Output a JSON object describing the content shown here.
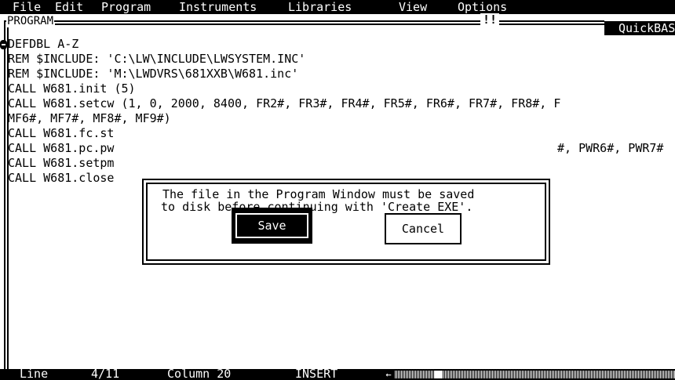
{
  "menu": [
    {
      "name": "menu-file",
      "label": "File"
    },
    {
      "name": "menu-edit",
      "label": "Edit"
    },
    {
      "name": "menu-program",
      "label": "Program"
    },
    {
      "name": "menu-instruments",
      "label": "Instruments"
    },
    {
      "name": "menu-libraries",
      "label": "Libraries"
    },
    {
      "name": "menu-view",
      "label": "View"
    },
    {
      "name": "menu-options",
      "label": "Options"
    }
  ],
  "window": {
    "title": "PROGRAM",
    "marker": "!!",
    "brand": "QuickBASIC"
  },
  "code": {
    "lines": [
      "DEFDBL A-Z",
      "REM $INCLUDE: 'C:\\LW\\INCLUDE\\LWSYSTEM.INC'",
      "REM $INCLUDE: 'M:\\LWDVRS\\681XXB\\W681.inc'",
      "CALL W681.init (5)",
      "CALL W681.setcw (1, 0, 2000, 8400, FR2#, FR3#, FR4#, FR5#, FR6#, FR7#, FR8#, F",
      "MF6#, MF7#, MF8#, MF9#)",
      "CALL W681.fc.st",
      "CALL W681.pc.pw",
      "CALL W681.setpm",
      "CALL W681.close"
    ],
    "overflow_right": "#, PWR6#, PWR7#"
  },
  "dialog": {
    "message_line1": "The file in the Program Window must be saved",
    "message_line2": "to disk before continuing with 'Create EXE'.",
    "save_label": "Save",
    "cancel_label": "Cancel"
  },
  "status": {
    "line_label": "Line",
    "line_value": "4/11",
    "column": "Column 20",
    "mode": "INSERT"
  },
  "hscroll_position": 0.15
}
